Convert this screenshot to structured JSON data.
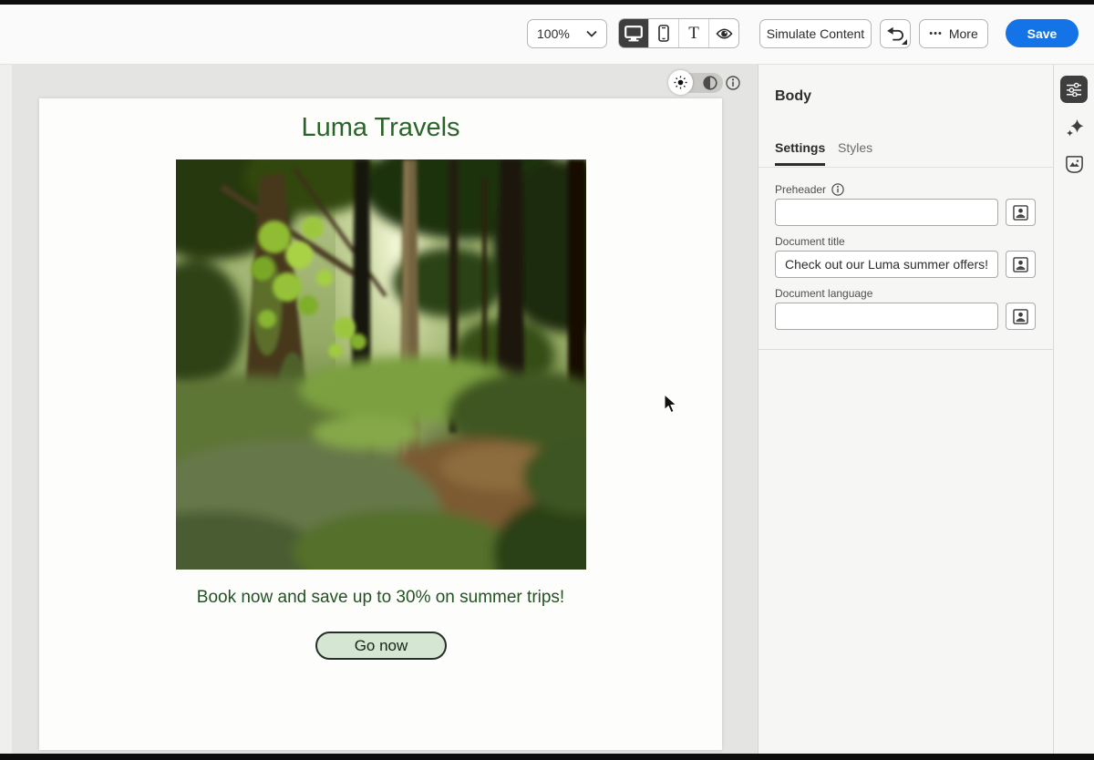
{
  "toolbar": {
    "zoom_value": "100%",
    "simulate_button": "Simulate Content",
    "more_dots": "•••",
    "more_label": "More",
    "save_label": "Save",
    "text_tool_glyph": "T"
  },
  "panel": {
    "title": "Body",
    "tabs": [
      {
        "label": "Settings"
      },
      {
        "label": "Styles"
      }
    ],
    "fields": [
      {
        "label": "Preheader",
        "value": "",
        "has_info": true
      },
      {
        "label": "Document title",
        "value": "Check out our Luma summer offers!"
      },
      {
        "label": "Document language",
        "value": ""
      }
    ]
  },
  "email": {
    "heading": "Luma Travels",
    "body_text": "Book now and save up to 30% on summer trips!",
    "cta_label": "Go now"
  },
  "colors": {
    "accent_blue": "#1473e6",
    "email_green": "#2a642a",
    "cta_fill": "#d5e6d2",
    "selected_segment": "#3e3e3e"
  },
  "icons": {
    "zoom_chevron": "chevron-down",
    "device_desktop": "desktop-monitor",
    "device_mobile": "mobile-phone",
    "text_tool": "text-T",
    "preview_eye": "eye",
    "undo": "undo-arrow",
    "theme_light": "sun",
    "theme_dark": "contrast-circle",
    "info": "info-circle",
    "personalization": "person-badge",
    "rail_settings": "sliders",
    "rail_ai": "sparkles",
    "rail_assets": "asset-badge"
  }
}
